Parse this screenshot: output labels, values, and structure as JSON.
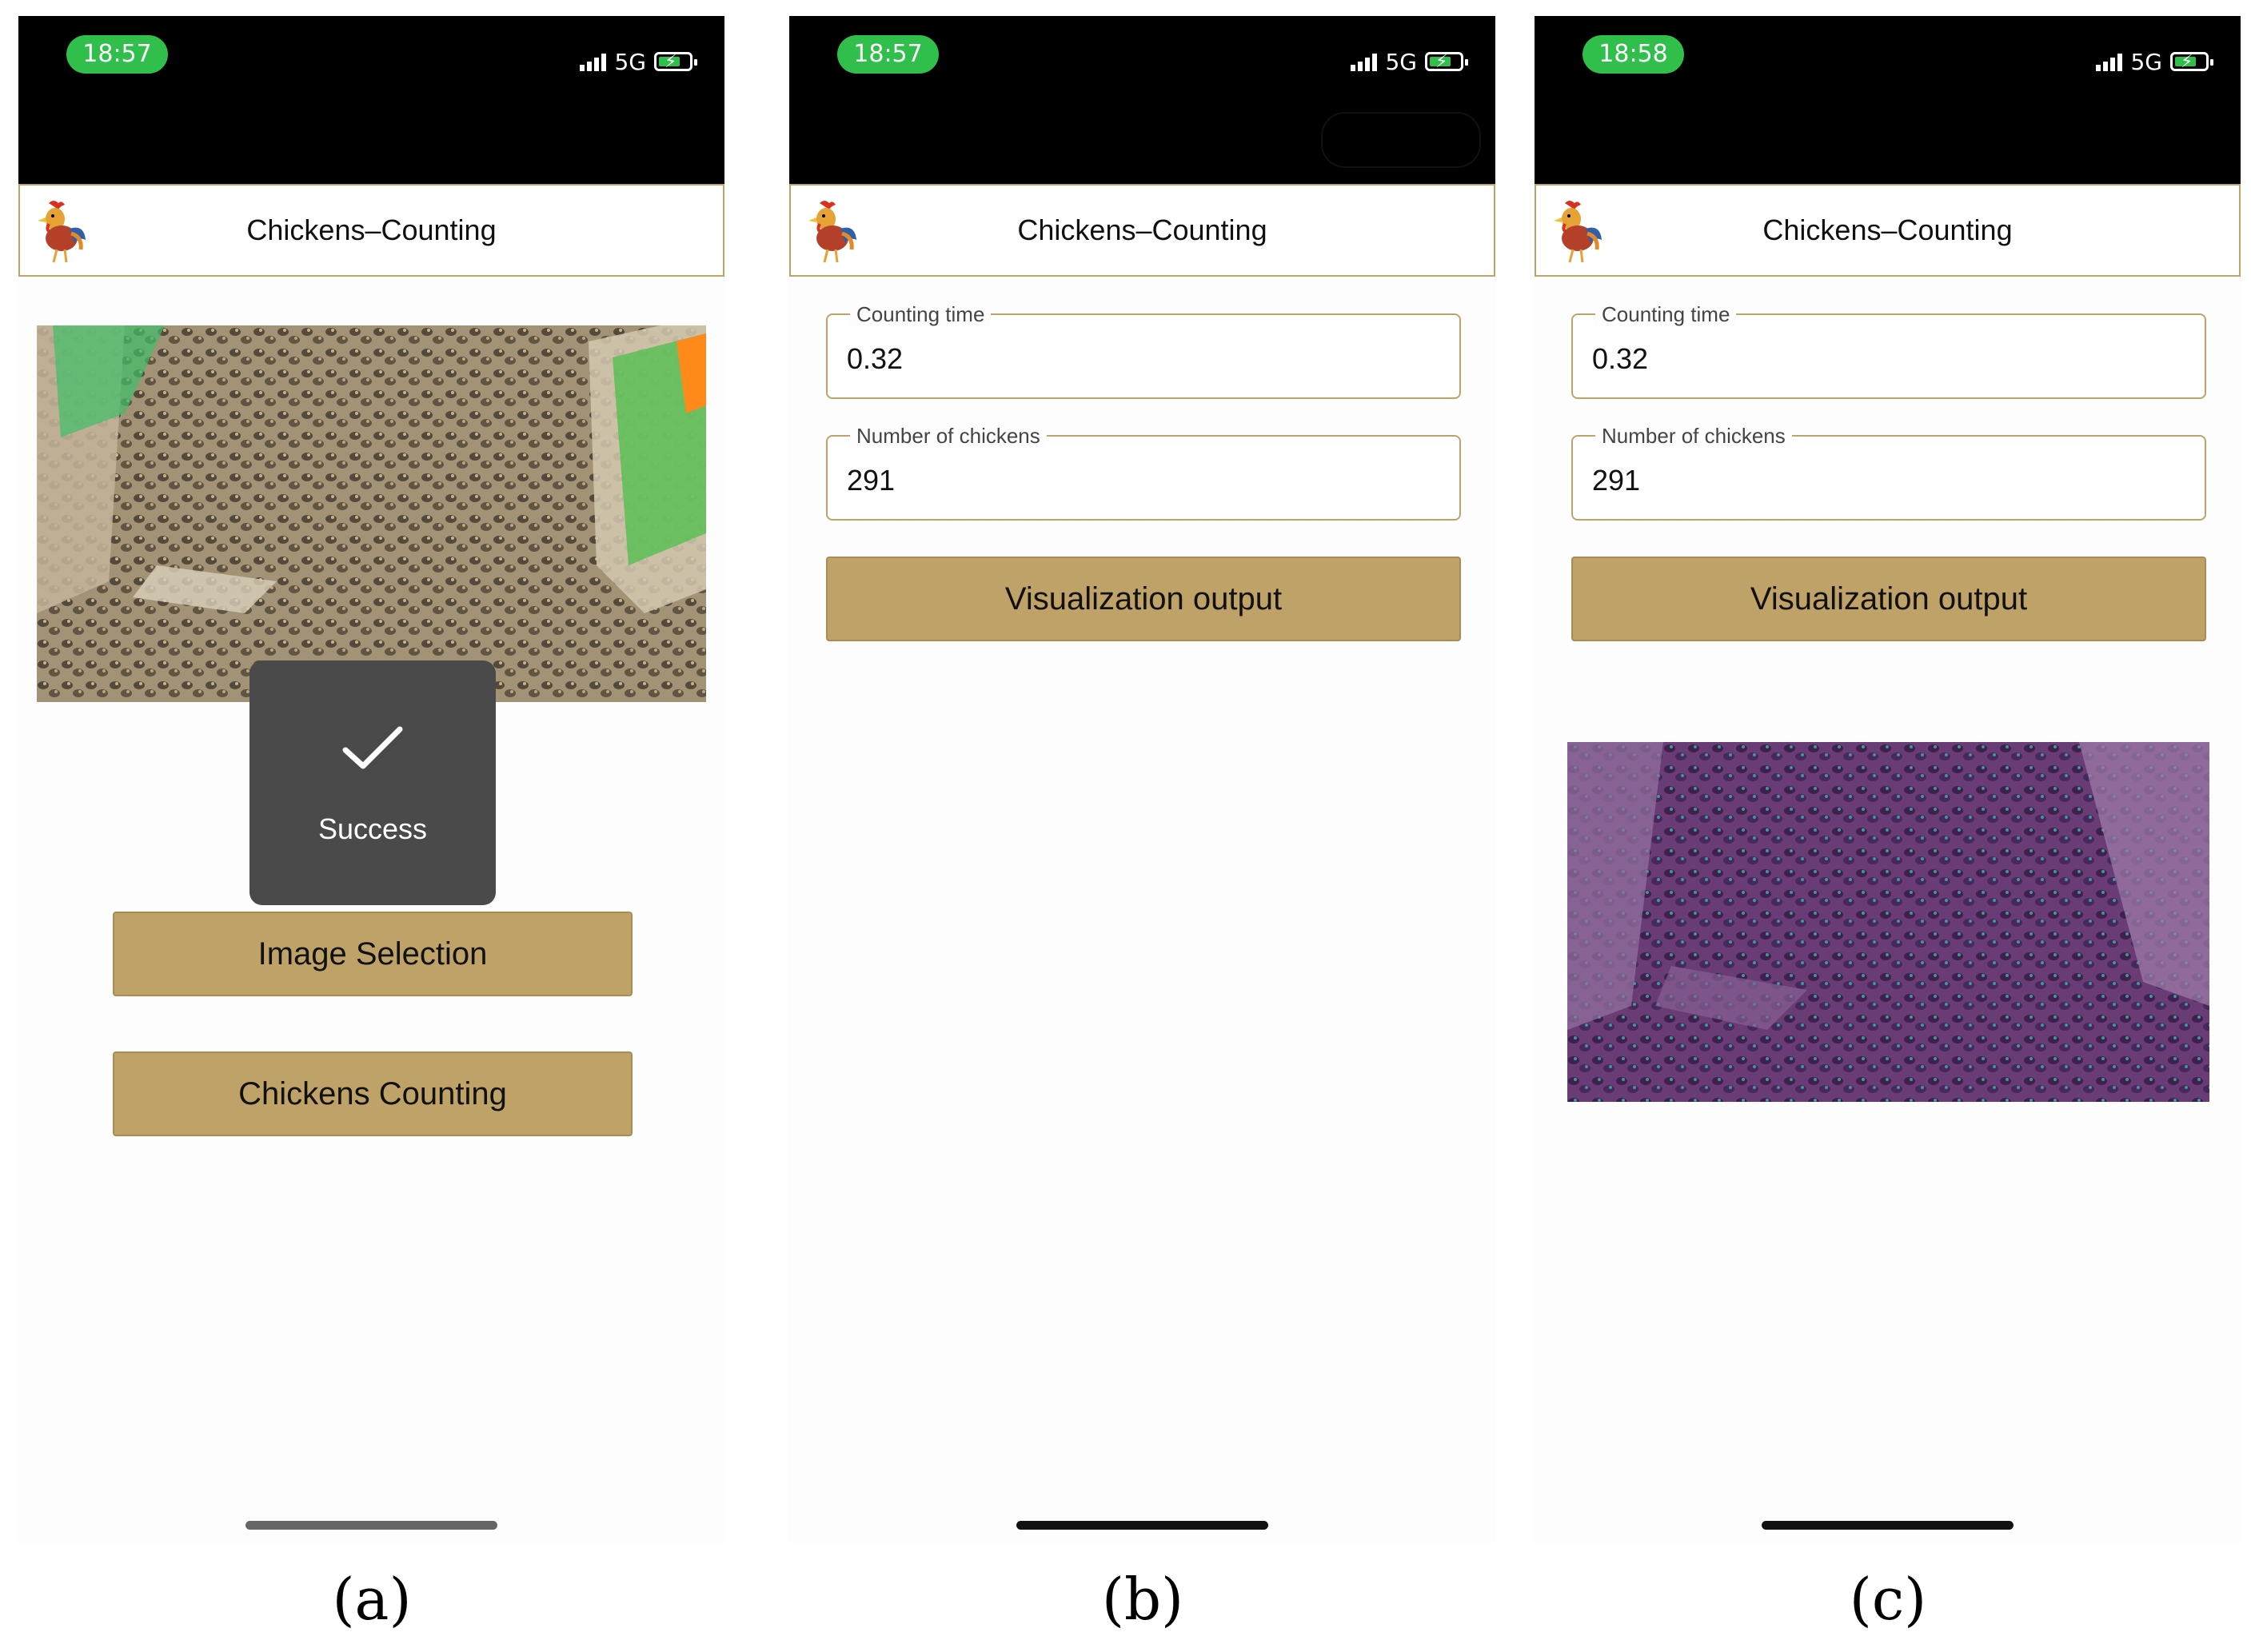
{
  "app": {
    "title": "Chickens–Counting",
    "logo_icon": "rooster-icon"
  },
  "colors": {
    "accent": "#bfa268",
    "status_pill": "#2fbf4a",
    "toast_bg": "#4a4a4a"
  },
  "status_icons": [
    "signal-icon",
    "battery-charging-icon"
  ],
  "panels": {
    "a": {
      "caption": "(a)",
      "status": {
        "time": "18:57",
        "network": "5G"
      },
      "toast": {
        "text": "Success",
        "icon": "checkmark-icon"
      },
      "buttons": {
        "image_selection": "Image Selection",
        "chickens_counting": "Chickens Counting"
      }
    },
    "b": {
      "caption": "(b)",
      "status": {
        "time": "18:57",
        "network": "5G"
      },
      "fields": {
        "counting_time": {
          "label": "Counting time",
          "value": "0.32"
        },
        "number_of_chickens": {
          "label": "Number of chickens",
          "value": "291"
        }
      },
      "buttons": {
        "visualization_output": "Visualization output"
      }
    },
    "c": {
      "caption": "(c)",
      "status": {
        "time": "18:58",
        "network": "5G"
      },
      "fields": {
        "counting_time": {
          "label": "Counting time",
          "value": "0.32"
        },
        "number_of_chickens": {
          "label": "Number of chickens",
          "value": "291"
        }
      },
      "buttons": {
        "visualization_output": "Visualization output"
      }
    }
  }
}
